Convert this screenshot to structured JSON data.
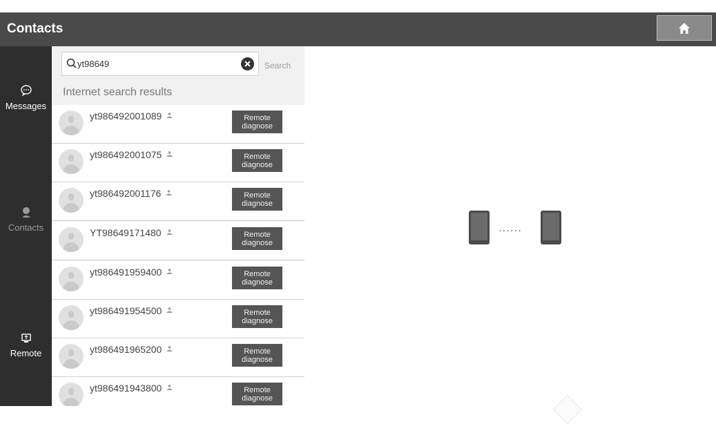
{
  "header": {
    "title": "Contacts",
    "home_icon": "home-icon"
  },
  "sidebar": {
    "items": [
      {
        "label": "Messages",
        "icon": "message-bubble-icon",
        "active": true
      },
      {
        "label": "Contacts",
        "icon": "person-icon",
        "active": false
      },
      {
        "label": "Remote",
        "icon": "remote-desktop-icon",
        "active": true
      }
    ]
  },
  "search": {
    "value": "yt98649",
    "button_label": "Search"
  },
  "results": {
    "heading": "Internet search results",
    "action_label": "Remote\ndiagnose",
    "contacts": [
      {
        "name": "yt986492001089"
      },
      {
        "name": "yt986492001075"
      },
      {
        "name": "yt986492001176"
      },
      {
        "name": "YT98649171480"
      },
      {
        "name": "yt986491959400"
      },
      {
        "name": "yt986491954500"
      },
      {
        "name": "yt986491965200"
      },
      {
        "name": "yt986491943800"
      }
    ]
  },
  "detail": {
    "dots": "······"
  }
}
